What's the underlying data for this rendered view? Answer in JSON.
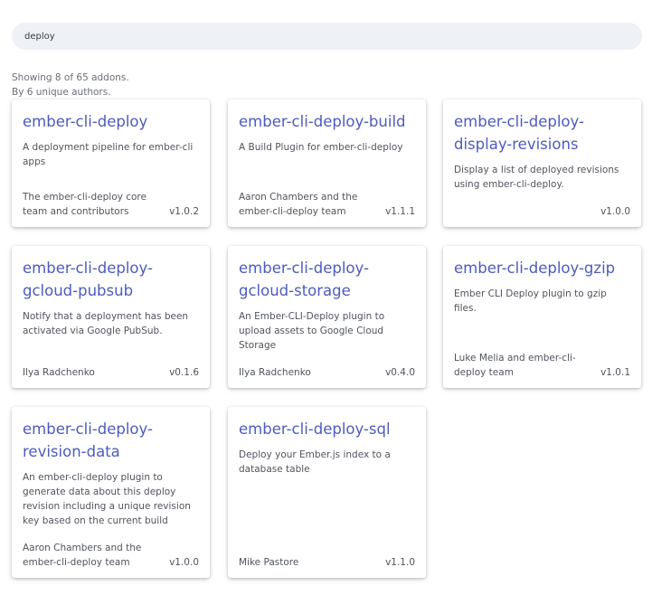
{
  "search": {
    "value": "deploy",
    "placeholder": ""
  },
  "summary": {
    "showing": "Showing 8 of 65 addons.",
    "authors": "By 6 unique authors."
  },
  "addons": [
    {
      "name": "ember-cli-deploy",
      "description": "A deployment pipeline for ember-cli apps",
      "author": "The ember-cli-deploy core team and contributors",
      "version": "v1.0.2"
    },
    {
      "name": "ember-cli-deploy-build",
      "description": "A Build Plugin for ember-cli-deploy",
      "author": "Aaron Chambers and the ember-cli-deploy team",
      "version": "v1.1.1"
    },
    {
      "name": "ember-cli-deploy-display-revisions",
      "description": "Display a list of deployed revisions using ember-cli-deploy.",
      "author": "",
      "version": "v1.0.0"
    },
    {
      "name": "ember-cli-deploy-gcloud-pubsub",
      "description": "Notify that a deployment has been activated via Google PubSub.",
      "author": "Ilya Radchenko",
      "version": "v0.1.6"
    },
    {
      "name": "ember-cli-deploy-gcloud-storage",
      "description": "An Ember-CLI-Deploy plugin to upload assets to Google Cloud Storage",
      "author": "Ilya Radchenko",
      "version": "v0.4.0"
    },
    {
      "name": "ember-cli-deploy-gzip",
      "description": "Ember CLI Deploy plugin to gzip files.",
      "author": "Luke Melia and ember-cli-deploy team",
      "version": "v1.0.1"
    },
    {
      "name": "ember-cli-deploy-revision-data",
      "description": "An ember-cli-deploy plugin to generate data about this deploy revision including a unique revision key based on the current build",
      "author": "Aaron Chambers and the ember-cli-deploy team",
      "version": "v1.0.0"
    },
    {
      "name": "ember-cli-deploy-sql",
      "description": "Deploy your Ember.js index to a database table",
      "author": "Mike Pastore",
      "version": "v1.1.0"
    }
  ]
}
